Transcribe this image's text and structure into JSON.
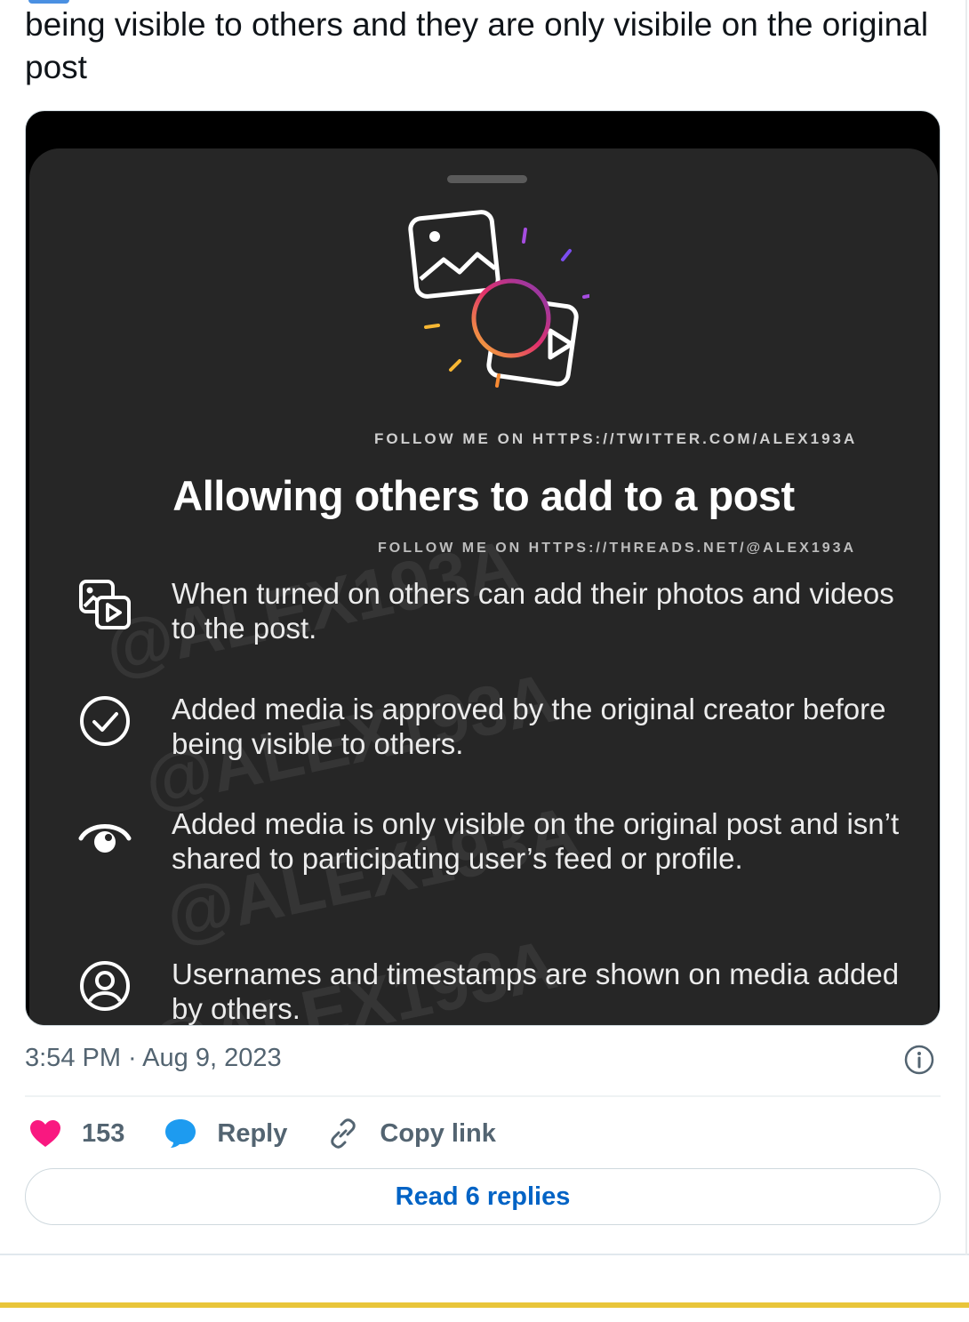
{
  "tweet": {
    "text": "being visible to others and they are only visibile on the original post"
  },
  "media": {
    "watermark_twitter": "FOLLOW ME ON HTTPS://TWITTER.COM/ALEX193A",
    "watermark_threads": "FOLLOW ME ON HTTPS://THREADS.NET/@ALEX193A",
    "background_watermark": "@ALEX193A",
    "title": "Allowing others to add to a post",
    "features": [
      {
        "icon": "media-add-icon",
        "text": "When turned on others can add their photos and videos to the post."
      },
      {
        "icon": "check-circle-icon",
        "text": "Added media is approved by the original creator before being visible to others."
      },
      {
        "icon": "eye-icon",
        "text": "Added media is only visible on the original post and isn’t shared to participating user’s feed or profile."
      },
      {
        "icon": "user-circle-icon",
        "text": "Usernames and timestamps are shown on media added by others."
      }
    ]
  },
  "meta": {
    "timestamp": "3:54 PM · Aug 9, 2023"
  },
  "actions": {
    "like_count": "153",
    "reply_label": "Reply",
    "copy_label": "Copy link"
  },
  "read_replies_label": "Read 6 replies",
  "colors": {
    "like": "#f91880",
    "reply": "#1d9bf0",
    "link": "#0063c5",
    "sheet_bg": "#262626",
    "accent_gold": "#e9c53a"
  }
}
